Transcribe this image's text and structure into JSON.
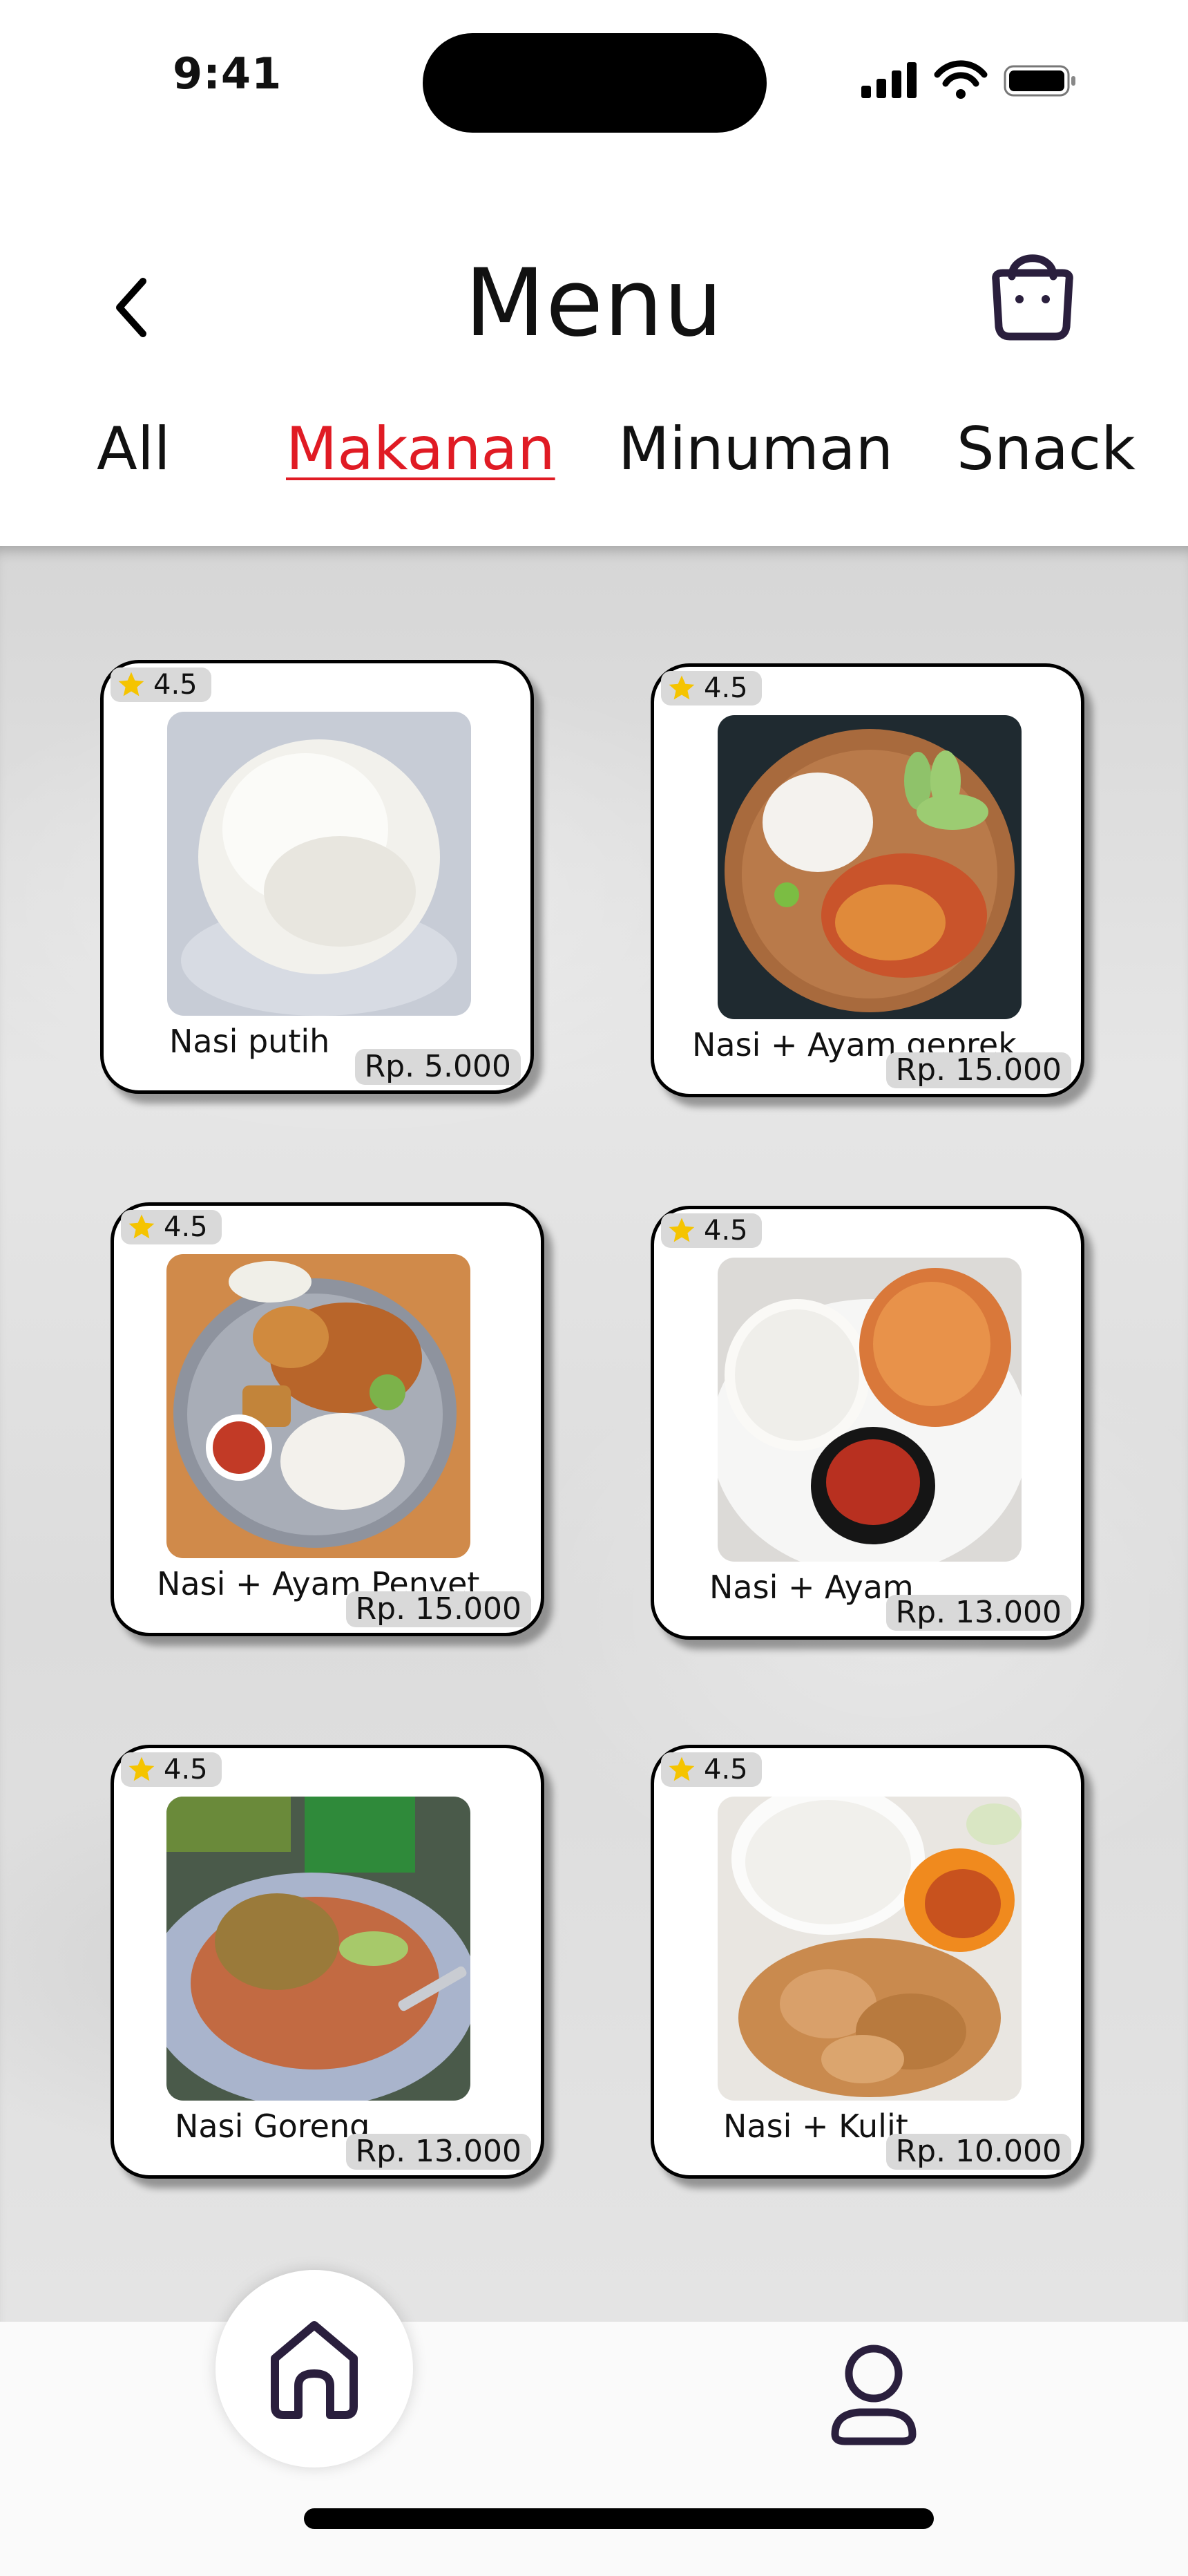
{
  "status_bar": {
    "time": "9:41"
  },
  "header": {
    "title": "Menu"
  },
  "icons": {
    "back": "chevron-left-icon",
    "cart": "shopping-bag-icon",
    "home": "home-icon",
    "profile": "user-icon",
    "rating": "star-icon"
  },
  "tabs": [
    {
      "label": "All",
      "active": false
    },
    {
      "label": "Makanan",
      "active": true
    },
    {
      "label": "Minuman",
      "active": false
    },
    {
      "label": "Snack",
      "active": false
    }
  ],
  "menu_items": [
    {
      "name": "Nasi putih",
      "price": "Rp. 5.000",
      "rating": "4.5"
    },
    {
      "name": "Nasi + Ayam geprek",
      "price": "Rp. 15.000",
      "rating": "4.5"
    },
    {
      "name": "Nasi + Ayam Penyet",
      "price": "Rp. 15.000",
      "rating": "4.5"
    },
    {
      "name": "Nasi + Ayam",
      "price": "Rp. 13.000",
      "rating": "4.5"
    },
    {
      "name": "Nasi Goreng",
      "price": "Rp. 13.000",
      "rating": "4.5"
    },
    {
      "name": "Nasi + Kulit",
      "price": "Rp. 10.000",
      "rating": "4.5"
    }
  ],
  "colors": {
    "active_tab": "#e01b24",
    "icon_dark": "#2a1f3d",
    "star": "#f5c400"
  }
}
